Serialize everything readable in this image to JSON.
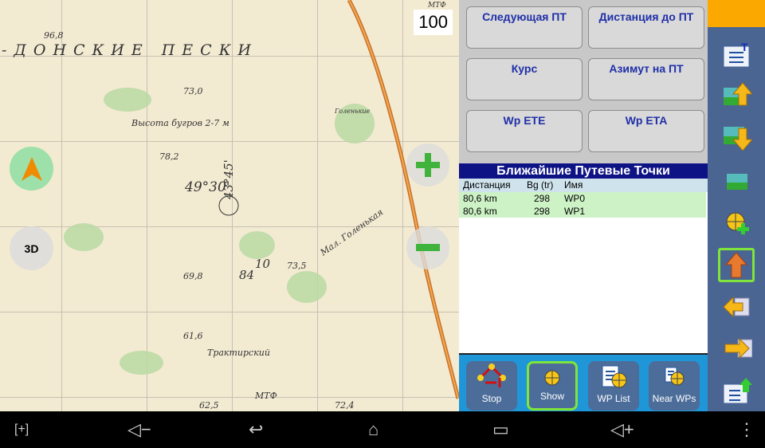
{
  "map": {
    "scale": "100",
    "mode_3d": "3D",
    "labels": [
      "96,8",
      "73,0",
      "Высота бугров 2-7 м",
      "78,2",
      "49°30'",
      "43°45'",
      "69,8",
      "84",
      "10",
      "73,5",
      "61,6",
      "Трактирский",
      "МТФ",
      "62,5",
      "72,4",
      "Мал. Голенькая",
      "МТФ",
      "Голенькие"
    ],
    "region": "-ДОНСКИЕ ПЕСКИ"
  },
  "data_buttons": [
    "Следующая ПТ",
    "Дистанция до ПТ",
    "Курс",
    "Азимут на ПТ",
    "Wp ETE",
    "Wp ETA"
  ],
  "nearest": {
    "title": "Ближайшие Путевые Точки",
    "columns": [
      "Дистанция",
      "Bg (tr)",
      "Имя"
    ],
    "rows": [
      {
        "dist": "80,6 km",
        "bg": "298",
        "name": "WP0"
      },
      {
        "dist": "80,6 km",
        "bg": "298",
        "name": "WP1"
      }
    ]
  },
  "bottom_buttons": [
    "Stop",
    "Show",
    "WP List",
    "Near WPs"
  ],
  "colors": {
    "accent": "#fba800",
    "toolbar": "#4a6592",
    "header": "#0d1285",
    "rows": "#cdf2c6"
  }
}
